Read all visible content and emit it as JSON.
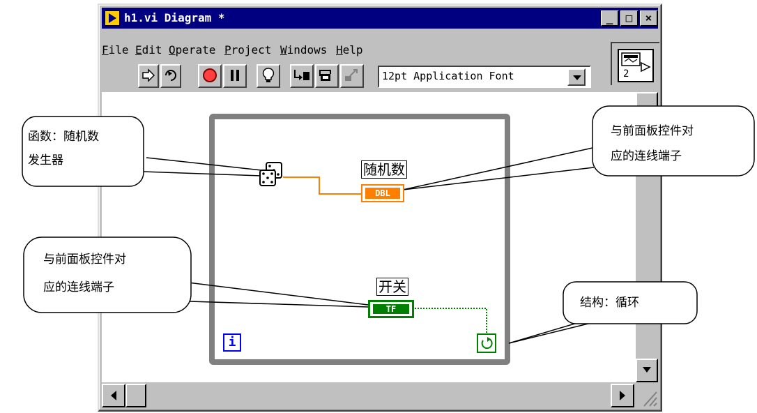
{
  "window": {
    "title": "h1.vi Diagram *",
    "controls": {
      "minimize": "_",
      "maximize": "□",
      "close": "×"
    }
  },
  "menubar": [
    "File",
    "Edit",
    "Operate",
    "Project",
    "Windows",
    "Help"
  ],
  "toolbar": {
    "font_selector_value": "12pt Application Font",
    "buttons": [
      "run-arrow-icon",
      "run-continuously-icon",
      "abort-icon",
      "pause-icon",
      "highlight-bulb-icon",
      "step-into-icon",
      "step-over-icon",
      "step-out-icon"
    ]
  },
  "connector_pane": {
    "label": "2"
  },
  "diagram": {
    "indicator_label": "随机数",
    "indicator_terminal": "DBL",
    "control_label": "开关",
    "control_terminal": "TF",
    "iteration_terminal": "i",
    "colors": {
      "numeric_wire": "#ff8000",
      "boolean_wire": "#008000",
      "loop_border": "#808080"
    }
  },
  "callouts": {
    "random_function": {
      "line1": "函数：随机数",
      "line2": "发生器"
    },
    "indicator_terminal": {
      "line1": "与前面板控件对",
      "line2": "应的连线端子"
    },
    "control_terminal": {
      "line1": "与前面板控件对",
      "line2": "应的连线端子"
    },
    "loop_structure": {
      "line1": "结构：循环"
    }
  }
}
